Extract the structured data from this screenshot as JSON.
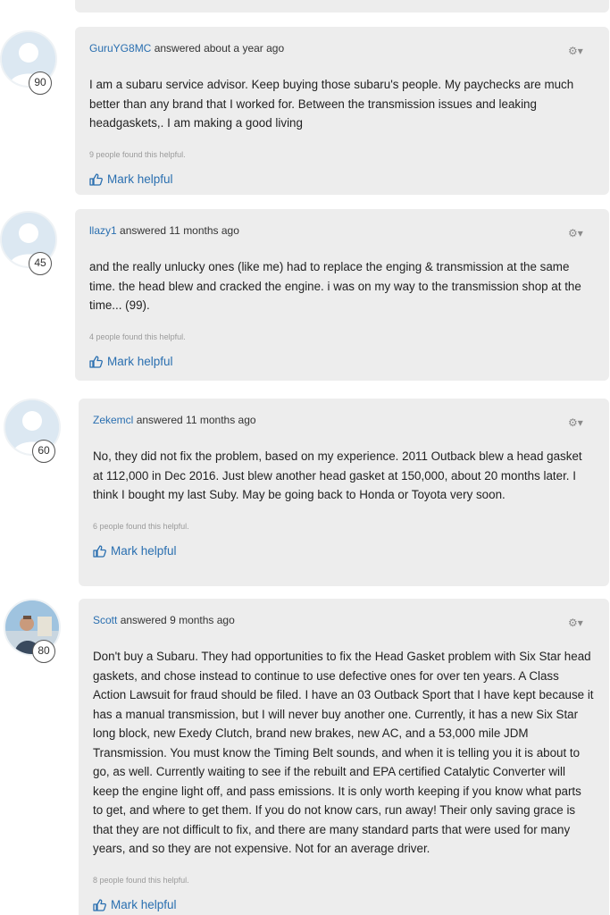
{
  "answers": [
    {
      "username": "GuruYG8MC",
      "answered_text": "answered about a year ago",
      "score": "90",
      "body": "I am a subaru service advisor. Keep buying those subaru's people. My paychecks are much better than any brand that I worked for. Between the transmission issues and leaking headgaskets,. I am making a good living",
      "helpful_text": "9 people found this helpful.",
      "mark_label": "Mark helpful",
      "avatar": "default-avatar"
    },
    {
      "username": "llazy1",
      "answered_text": "answered 11 months ago",
      "score": "45",
      "body": "and the really unlucky ones (like me) had to replace the enging & transmission at the same time. the head blew and cracked the engine. i was on my way to the transmission shop at the time... (99).",
      "helpful_text": "4 people found this helpful.",
      "mark_label": "Mark helpful",
      "avatar": "default-avatar"
    },
    {
      "username": "Zekemcl",
      "answered_text": "answered 11 months ago",
      "score": "60",
      "body": "No, they did not fix the problem, based on my experience. 2011 Outback blew a head gasket at 112,000 in Dec 2016. Just blew another head gasket at 150,000, about 20 months later. I think I bought my last Suby. May be going back to Honda or Toyota very soon.",
      "helpful_text": "6 people found this helpful.",
      "mark_label": "Mark helpful",
      "avatar": "default-avatar"
    },
    {
      "username": "Scott",
      "answered_text": "answered 9 months ago",
      "score": "80",
      "body": "Don't buy a Subaru. They had opportunities to fix the Head Gasket problem with Six Star head gaskets, and chose instead to continue to use defective ones for over ten years. A Class Action Lawsuit for fraud should be filed. I have an 03 Outback Sport that I have kept because it has a manual transmission, but I will never buy another one. Currently, it has a new Six Star long block, new Exedy Clutch, brand new brakes, new AC, and a 53,000 mile JDM Transmission. You must know the Timing Belt sounds, and when it is telling you it is about to go, as well. Currently waiting to see if the rebuilt and EPA certified Catalytic Converter will keep the engine light off, and pass emissions. It is only worth keeping if you know what parts to get, and where to get them. If you do not know cars, run away! Their only saving grace is that they are not difficult to fix, and there are many standard parts that were used for many years, and so they are not expensive. Not for an average driver.",
      "helpful_text": "8 people found this helpful.",
      "mark_label": "Mark helpful",
      "avatar": "photo-avatar"
    }
  ],
  "colors": {
    "card_bg": "#ededed",
    "link": "#2a6fb0",
    "muted": "#9a9a9a"
  }
}
